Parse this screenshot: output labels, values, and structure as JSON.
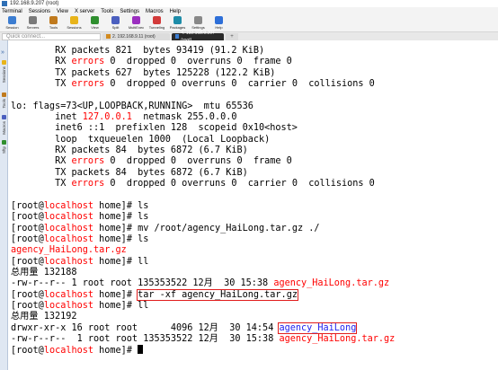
{
  "window": {
    "title": "192.168.9.207 (root)"
  },
  "menu": [
    "Terminal",
    "Sessions",
    "View",
    "X server",
    "Tools",
    "Settings",
    "Macros",
    "Help"
  ],
  "toolbar": [
    {
      "label": "Session",
      "icon": "session-icon",
      "color": "#3c7dd1"
    },
    {
      "label": "Servers",
      "icon": "servers-icon",
      "color": "#7a7a7a"
    },
    {
      "label": "Tools",
      "icon": "tools-icon",
      "color": "#c07a1e"
    },
    {
      "label": "Sessions",
      "icon": "star-icon",
      "color": "#e8b41a"
    },
    {
      "label": "View",
      "icon": "view-icon",
      "color": "#2f8f2f"
    },
    {
      "label": "Split",
      "icon": "split-icon",
      "color": "#4b5fbf"
    },
    {
      "label": "MultiExec",
      "icon": "multiexec-icon",
      "color": "#9b2fc0"
    },
    {
      "label": "Tunneling",
      "icon": "tunneling-icon",
      "color": "#d23a3a"
    },
    {
      "label": "Packages",
      "icon": "packages-icon",
      "color": "#1e8ca8"
    },
    {
      "label": "Settings",
      "icon": "settings-icon",
      "color": "#888888"
    },
    {
      "label": "Help",
      "icon": "help-icon",
      "color": "#2e6fd8"
    }
  ],
  "quick_connect": {
    "placeholder": "Quick connect..."
  },
  "tabs": [
    {
      "label": "2. 192.168.9.11 (root)",
      "active": false
    },
    {
      "label": "4. 192.168.9.207 (root)",
      "active": true
    }
  ],
  "sidebar": [
    "Sessions",
    "Tools",
    "Macros",
    "Sftp"
  ],
  "terminal": {
    "lines": [
      [
        {
          "t": "        RX packets 821  bytes 93419 (91.2 KiB)"
        }
      ],
      [
        {
          "t": "        RX "
        },
        {
          "t": "errors",
          "c": "red"
        },
        {
          "t": " 0  dropped 0  overruns 0  frame 0"
        }
      ],
      [
        {
          "t": "        TX packets 627  bytes 125228 (122.2 KiB)"
        }
      ],
      [
        {
          "t": "        TX "
        },
        {
          "t": "errors",
          "c": "red"
        },
        {
          "t": " 0  dropped 0 overruns 0  carrier 0  collisions 0"
        }
      ],
      [
        {
          "t": ""
        }
      ],
      [
        {
          "t": "lo: flags=73<UP,LOOPBACK,RUNNING>  mtu 65536"
        }
      ],
      [
        {
          "t": "        inet "
        },
        {
          "t": "127.0.0.1",
          "c": "red"
        },
        {
          "t": "  netmask 255.0.0.0"
        }
      ],
      [
        {
          "t": "        inet6 ::1  prefixlen 128  scopeid 0x10<host>"
        }
      ],
      [
        {
          "t": "        loop  txqueuelen 1000  (Local Loopback)"
        }
      ],
      [
        {
          "t": "        RX packets 84  bytes 6872 (6.7 KiB)"
        }
      ],
      [
        {
          "t": "        RX "
        },
        {
          "t": "errors",
          "c": "red"
        },
        {
          "t": " 0  dropped 0  overruns 0  frame 0"
        }
      ],
      [
        {
          "t": "        TX packets 84  bytes 6872 (6.7 KiB)"
        }
      ],
      [
        {
          "t": "        TX "
        },
        {
          "t": "errors",
          "c": "red"
        },
        {
          "t": " 0  dropped 0 overruns 0  carrier 0  collisions 0"
        }
      ],
      [
        {
          "t": ""
        }
      ],
      [
        {
          "t": "[root@"
        },
        {
          "t": "localhost",
          "c": "red"
        },
        {
          "t": " home]# ls"
        }
      ],
      [
        {
          "t": "[root@"
        },
        {
          "t": "localhost",
          "c": "red"
        },
        {
          "t": " home]# ls"
        }
      ],
      [
        {
          "t": "[root@"
        },
        {
          "t": "localhost",
          "c": "red"
        },
        {
          "t": " home]# mv /root/agency_HaiLong.tar.gz ./"
        }
      ],
      [
        {
          "t": "[root@"
        },
        {
          "t": "localhost",
          "c": "red"
        },
        {
          "t": " home]# ls"
        }
      ],
      [
        {
          "t": "agency_HaiLong.tar.gz",
          "c": "red"
        }
      ],
      [
        {
          "t": "[root@"
        },
        {
          "t": "localhost",
          "c": "red"
        },
        {
          "t": " home]# ll"
        }
      ],
      [
        {
          "t": "总用量 132188"
        }
      ],
      [
        {
          "t": "-rw-r--r-- 1 root root 135353522 12月  30 15:38 "
        },
        {
          "t": "agency_HaiLong.tar.gz",
          "c": "red"
        }
      ],
      [
        {
          "t": "[root@"
        },
        {
          "t": "localhost",
          "c": "red"
        },
        {
          "t": " home]# "
        },
        {
          "t": "tar -xf agency_HaiLong.tar.gz",
          "hl": true
        }
      ],
      [
        {
          "t": "[root@"
        },
        {
          "t": "localhost",
          "c": "red"
        },
        {
          "t": " home]# ll"
        }
      ],
      [
        {
          "t": "总用量 132192"
        }
      ],
      [
        {
          "t": "drwxr-xr-x 16 root root      4096 12月  30 14:54 "
        },
        {
          "t": "agency_HaiLong",
          "c": "hl-blue-text",
          "hl": true
        }
      ],
      [
        {
          "t": "-rw-r--r--  1 root root 135353522 12月  30 15:38 "
        },
        {
          "t": "agency_HaiLong.tar.gz",
          "c": "red"
        }
      ],
      [
        {
          "t": "[root@"
        },
        {
          "t": "localhost",
          "c": "red"
        },
        {
          "t": " home]# "
        },
        {
          "t": "",
          "cursor": true
        }
      ]
    ]
  }
}
